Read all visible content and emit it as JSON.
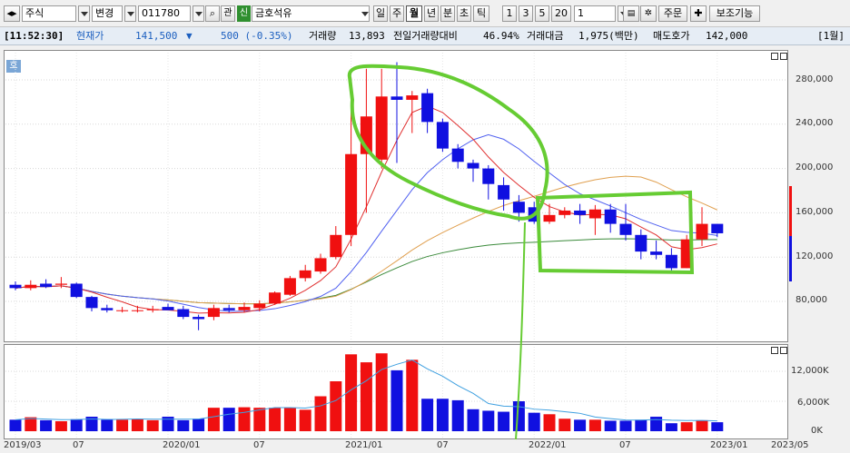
{
  "toolbar": {
    "market": "주식",
    "change_label": "변경",
    "code": "011780",
    "fin_label": "관",
    "badge": "신",
    "stock_name": "금호석유",
    "period_buttons": [
      "일",
      "주",
      "월",
      "년",
      "분",
      "초",
      "틱"
    ],
    "selected_period": "월",
    "number_buttons": [
      "1",
      "3",
      "5",
      "20"
    ],
    "count_value": "1",
    "order_label": "주문",
    "aux_label": "보조기능"
  },
  "infobar": {
    "time": "[11:52:30]",
    "price_label": "현재가",
    "price": "141,500",
    "change_arrow": "▼",
    "change": "500 (-0.35%)",
    "volume_label": "거래량",
    "volume": "13,893",
    "prev_ratio_label": "전일거래량대비",
    "prev_ratio": "46.94%",
    "amount_label": "거래대금",
    "amount": "1,975(백만)",
    "ask_label": "매도호가",
    "ask": "142,000",
    "period_badge": "[1월]"
  },
  "price_pane": {
    "corner_label": "호",
    "y_ticks": [
      "280,000",
      "240,000",
      "200,000",
      "160,000",
      "120,000",
      "80,000"
    ]
  },
  "volume_pane": {
    "y_ticks": [
      "12,000K",
      "6,000K",
      "0K"
    ]
  },
  "x_axis": {
    "ticks": [
      "2019/03",
      "07",
      "2020/01",
      "07",
      "2021/01",
      "07",
      "2022/01",
      "07",
      "2023/01",
      "2023/05"
    ]
  },
  "colors": {
    "up": "#f01010",
    "down": "#1010e0",
    "ma5": "#e03030",
    "ma10": "#5060f0",
    "ma20": "#e0a050",
    "ma60": "#3a8a3a",
    "highlight": "#66cc33",
    "vol_ma": "#3fa0e0"
  },
  "chart_data": {
    "type": "candlestick",
    "unit": "KRW, monthly",
    "x": [
      "2019/03",
      "2019/04",
      "2019/05",
      "2019/06",
      "2019/07",
      "2019/08",
      "2019/09",
      "2019/10",
      "2019/11",
      "2019/12",
      "2020/01",
      "2020/02",
      "2020/03",
      "2020/04",
      "2020/05",
      "2020/06",
      "2020/07",
      "2020/08",
      "2020/09",
      "2020/10",
      "2020/11",
      "2020/12",
      "2021/01",
      "2021/02",
      "2021/03",
      "2021/04",
      "2021/05",
      "2021/06",
      "2021/07",
      "2021/08",
      "2021/09",
      "2021/10",
      "2021/11",
      "2021/12",
      "2022/01",
      "2022/02",
      "2022/03",
      "2022/04",
      "2022/05",
      "2022/06",
      "2022/07",
      "2022/08",
      "2022/09",
      "2022/10",
      "2022/11",
      "2022/12",
      "2023/01"
    ],
    "open": [
      95000,
      92000,
      96000,
      95000,
      96000,
      84000,
      74000,
      72000,
      72000,
      72000,
      75000,
      73000,
      66000,
      66000,
      74000,
      72000,
      74000,
      78000,
      86000,
      101000,
      107000,
      120000,
      140000,
      213000,
      208000,
      265000,
      262000,
      268000,
      242000,
      218000,
      205000,
      200000,
      185000,
      170000,
      165000,
      152000,
      158000,
      162000,
      155000,
      163000,
      150000,
      140000,
      125000,
      122000,
      110000,
      136000,
      150000
    ],
    "high": [
      98000,
      99000,
      100000,
      102000,
      97000,
      85000,
      77000,
      75000,
      76000,
      76000,
      78000,
      76000,
      68000,
      77000,
      77000,
      79000,
      81000,
      89000,
      103000,
      113000,
      123000,
      148000,
      282000,
      290000,
      290000,
      296000,
      270000,
      272000,
      245000,
      222000,
      208000,
      203000,
      192000,
      176000,
      170000,
      168000,
      165000,
      168000,
      167000,
      168000,
      168000,
      145000,
      135000,
      128000,
      140000,
      165000,
      150000
    ],
    "low": [
      90000,
      90000,
      92000,
      92000,
      83000,
      71000,
      70000,
      70000,
      70000,
      70000,
      72000,
      64000,
      54000,
      63000,
      70000,
      70000,
      71000,
      77000,
      85000,
      98000,
      105000,
      118000,
      130000,
      160000,
      200000,
      205000,
      232000,
      232000,
      215000,
      200000,
      188000,
      172000,
      162000,
      152000,
      150000,
      150000,
      155000,
      150000,
      140000,
      142000,
      135000,
      118000,
      118000,
      108000,
      110000,
      130000,
      138000
    ],
    "close": [
      92000,
      95000,
      93000,
      96000,
      84000,
      74000,
      72000,
      72000,
      72000,
      73000,
      72000,
      66000,
      64000,
      74000,
      72000,
      75000,
      78000,
      88000,
      101000,
      108000,
      119000,
      140000,
      213000,
      247000,
      265000,
      262000,
      266000,
      242000,
      218000,
      206000,
      200000,
      186000,
      172000,
      160000,
      152000,
      158000,
      162000,
      158000,
      163000,
      150000,
      140000,
      125000,
      122000,
      110000,
      136000,
      150000,
      141500
    ],
    "volume_k": [
      2300,
      2800,
      2200,
      2000,
      2400,
      2900,
      2300,
      2300,
      2400,
      2200,
      2900,
      2200,
      2500,
      4700,
      4700,
      4800,
      4700,
      4700,
      4700,
      4300,
      7000,
      10000,
      15400,
      13800,
      15600,
      12200,
      14300,
      6500,
      6500,
      6200,
      4400,
      4100,
      3900,
      6000,
      3700,
      3400,
      2500,
      2300,
      2300,
      2100,
      2100,
      2300,
      2900,
      1600,
      1800,
      2200,
      1800,
      0
    ],
    "ylim": [
      50000,
      300000
    ]
  }
}
